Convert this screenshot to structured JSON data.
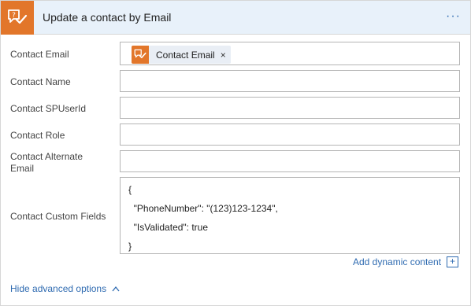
{
  "header": {
    "title": "Update a contact by Email",
    "more_label": "···",
    "icon": "chat-check-icon",
    "accent_color": "#e2762a"
  },
  "fields": {
    "contact_email": {
      "label": "Contact Email",
      "token_label": "Contact Email",
      "token_remove": "×"
    },
    "contact_name": {
      "label": "Contact Name",
      "value": ""
    },
    "contact_spuserid": {
      "label": "Contact SPUserId",
      "value": ""
    },
    "contact_role": {
      "label": "Contact Role",
      "value": ""
    },
    "contact_alternate_email": {
      "label_line1": "Contact Alternate",
      "label_line2": "Email",
      "value": ""
    },
    "contact_custom_fields": {
      "label": "Contact Custom Fields",
      "lines": [
        "{",
        "  \"PhoneNumber\": \"(123)123-1234\",",
        "  \"IsValidated\": true",
        "}"
      ]
    }
  },
  "add_dynamic_content": {
    "label": "Add dynamic content",
    "icon_label": "+"
  },
  "advanced": {
    "label": "Hide advanced options",
    "icon": "chevron-up-icon"
  },
  "link_color": "#2f6bb1"
}
